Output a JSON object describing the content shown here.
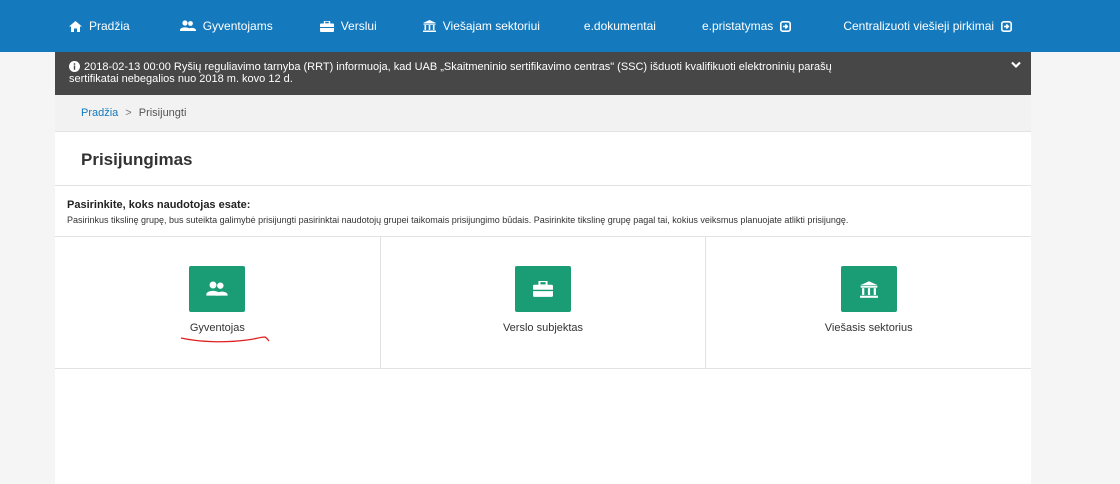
{
  "nav": {
    "items": [
      {
        "label": "Pradžia",
        "icon": "home-icon"
      },
      {
        "label": "Gyventojams",
        "icon": "users-icon"
      },
      {
        "label": "Verslui",
        "icon": "briefcase-icon"
      },
      {
        "label": "Viešajam sektoriui",
        "icon": "bank-icon"
      },
      {
        "label": "e.dokumentai"
      },
      {
        "label": "e.pristatymas",
        "icon": "external-link-icon"
      },
      {
        "label": "Centralizuoti viešieji pirkimai",
        "icon": "external-link-icon"
      }
    ]
  },
  "notice": {
    "line1": "2018-02-13 00:00   Ryšių reguliavimo tarnyba (RRT) informuoja, kad UAB „Skaitmeninio sertifikavimo centras\" (SSC) išduoti kvalifikuoti elektroninių parašų",
    "line2": "sertifikatai nebegalios nuo 2018 m. kovo 12 d."
  },
  "breadcrumb": {
    "home": "Pradžia",
    "separator": ">",
    "current": "Prisijungti"
  },
  "page": {
    "title": "Prisijungimas",
    "lead": "Pasirinkite, koks naudotojas esate:",
    "description": "Pasirinkus tikslinę grupę, bus suteikta galimybė prisijungti pasirinktai naudotojų grupei taikomais prisijungimo būdais. Pasirinkite tikslinę grupę pagal tai, kokius veiksmus planuojate atlikti prisijungę."
  },
  "choices": [
    {
      "label": "Gyventojas",
      "icon": "users-icon"
    },
    {
      "label": "Verslo subjektas",
      "icon": "briefcase-icon"
    },
    {
      "label": "Viešasis sektorius",
      "icon": "bank-icon"
    }
  ],
  "colors": {
    "nav_bg": "#1479bd",
    "notice_bg": "#474747",
    "tile_green": "#1a9c75",
    "annotation_red": "#e02020"
  }
}
